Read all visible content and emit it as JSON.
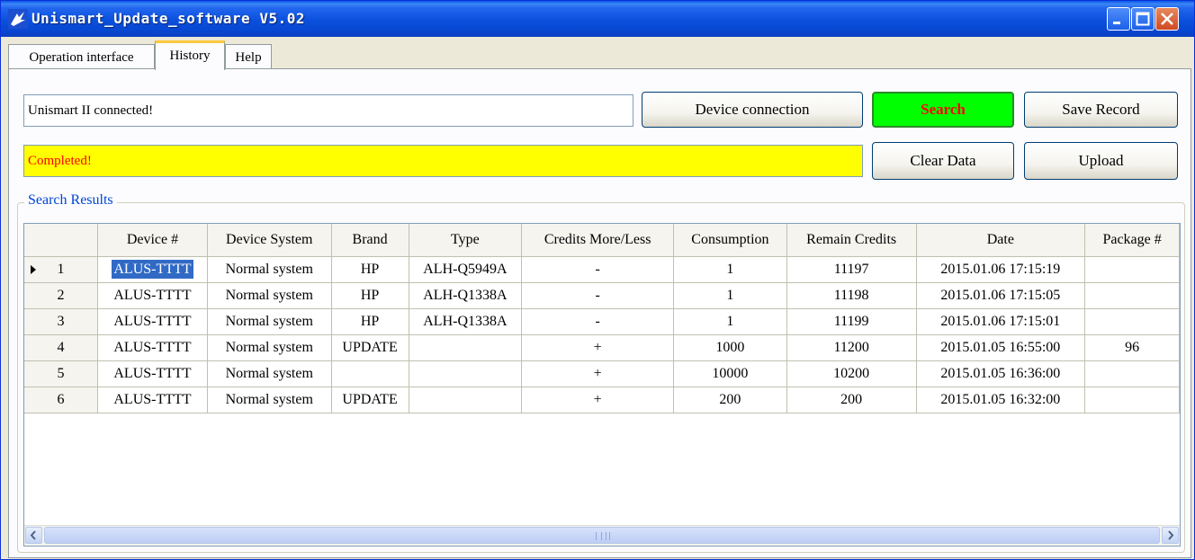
{
  "window": {
    "title": "Unismart_Update_software V5.02"
  },
  "tabs": [
    {
      "label": "Operation interface",
      "active": false
    },
    {
      "label": "History",
      "active": true
    },
    {
      "label": "Help",
      "active": false
    }
  ],
  "connection": {
    "status_value": "Unismart II connected!",
    "connect_button": "Device connection",
    "search_button": "Search",
    "save_button": "Save Record"
  },
  "progress": {
    "status_value": "Completed!",
    "clear_button": "Clear Data",
    "upload_button": "Upload"
  },
  "results": {
    "group_label": "Search Results",
    "columns": [
      "Device #",
      "Device System",
      "Brand",
      "Type",
      "Credits More/Less",
      "Consumption",
      "Remain Credits",
      "Date",
      "Package #"
    ],
    "rows": [
      {
        "num": "1",
        "device": "ALUS-TTTT",
        "system": "Normal system",
        "brand": "HP",
        "type": "ALH-Q5949A",
        "credits": "-",
        "consumption": "1",
        "remain": "11197",
        "date": "2015.01.06 17:15:19",
        "package": ""
      },
      {
        "num": "2",
        "device": "ALUS-TTTT",
        "system": "Normal system",
        "brand": "HP",
        "type": "ALH-Q1338A",
        "credits": "-",
        "consumption": "1",
        "remain": "11198",
        "date": "2015.01.06 17:15:05",
        "package": ""
      },
      {
        "num": "3",
        "device": "ALUS-TTTT",
        "system": "Normal system",
        "brand": "HP",
        "type": "ALH-Q1338A",
        "credits": "-",
        "consumption": "1",
        "remain": "11199",
        "date": "2015.01.06 17:15:01",
        "package": ""
      },
      {
        "num": "4",
        "device": "ALUS-TTTT",
        "system": "Normal system",
        "brand": "UPDATE",
        "type": "",
        "credits": "+",
        "consumption": "1000",
        "remain": "11200",
        "date": "2015.01.05 16:55:00",
        "package": "96"
      },
      {
        "num": "5",
        "device": "ALUS-TTTT",
        "system": "Normal system",
        "brand": "",
        "type": "",
        "credits": "+",
        "consumption": "10000",
        "remain": "10200",
        "date": "2015.01.05 16:36:00",
        "package": ""
      },
      {
        "num": "6",
        "device": "ALUS-TTTT",
        "system": "Normal system",
        "brand": "UPDATE",
        "type": "",
        "credits": "+",
        "consumption": "200",
        "remain": "200",
        "date": "2015.01.05 16:32:00",
        "package": ""
      }
    ]
  },
  "colors": {
    "search_bg": "#00ff00",
    "search_text": "#ff0000",
    "status_bg": "#ffff00",
    "status_text": "#ff0000",
    "selection": "#316ac5"
  }
}
